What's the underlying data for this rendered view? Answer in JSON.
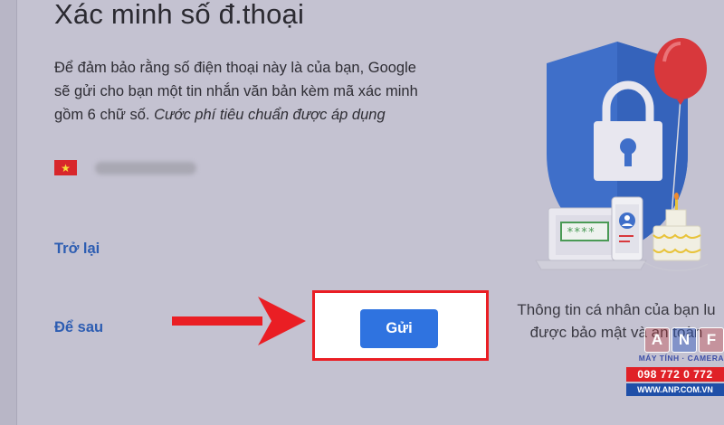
{
  "page": {
    "title": "Xác minh số đ.thoại",
    "description": "Để đảm bảo rằng số điện thoại này là của bạn, Google sẽ gửi cho bạn một tin nhắn văn bản kèm mã xác minh gồm 6 chữ số.",
    "description_italic": "Cước phí tiêu chuẩn được áp dụng",
    "flag_icon": "vietnam-flag-icon"
  },
  "actions": {
    "back_label": "Trở lại",
    "later_label": "Để sau",
    "send_label": "Gửi"
  },
  "illustration": {
    "screen_text": "****",
    "caption_line1": "Thông tin cá nhân của bạn lu",
    "caption_line2": "được bảo mật và an toàn"
  },
  "watermark": {
    "letters": [
      "A",
      "N",
      "F"
    ],
    "sub": "MÁY TÍNH · CAMERA",
    "phone": "098 772 0 772",
    "web": "WWW.ANP.COM.VN"
  },
  "colors": {
    "accent": "#2f73e0",
    "link": "#2d5db2",
    "highlight": "#ea1e24",
    "shield": "#3f6fc9"
  }
}
